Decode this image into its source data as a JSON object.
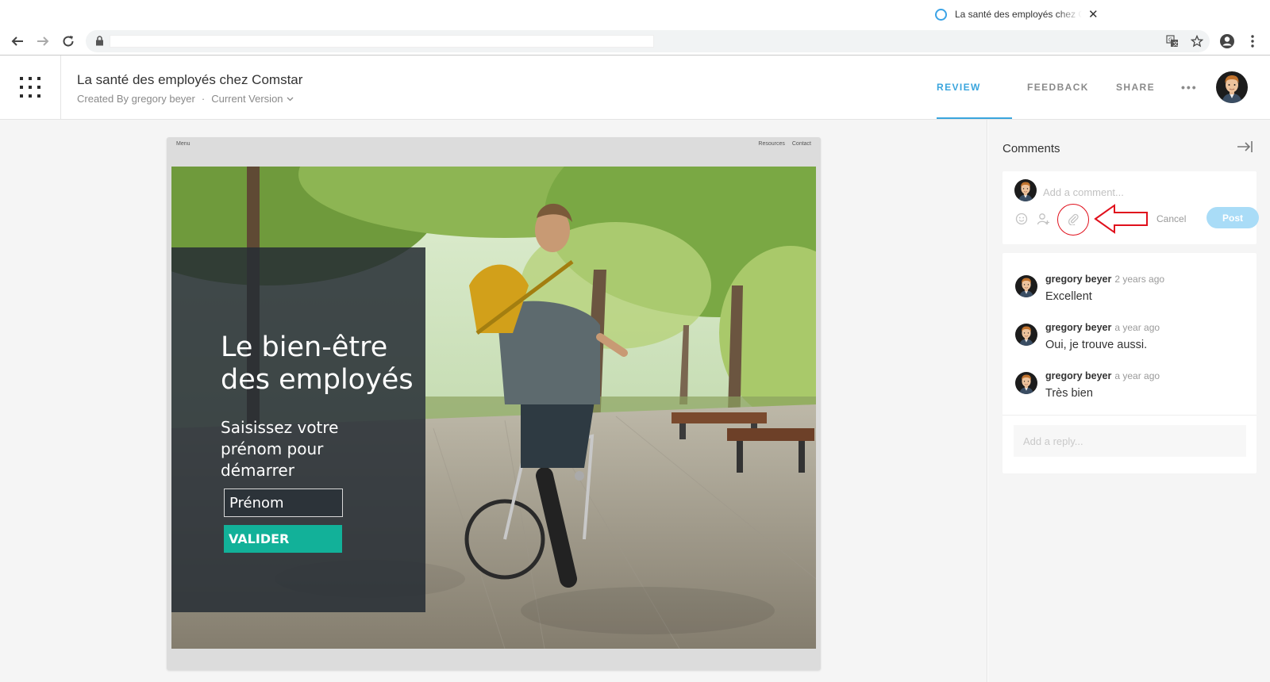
{
  "browser": {
    "tab_title": "La santé des employés chez Comstar",
    "tab_close": "✕"
  },
  "header": {
    "title": "La santé des employés chez Comstar",
    "created_by": "Created By gregory beyer",
    "separator": "·",
    "version": "Current Version",
    "nav": {
      "review": "REVIEW",
      "feedback": "FEEDBACK",
      "share": "SHARE",
      "more": "•••"
    }
  },
  "frame": {
    "nav_menu": "Menu",
    "nav_resources": "Resources",
    "nav_contact": "Contact",
    "hero_title_line1": "Le bien-être",
    "hero_title_line2": "des employés",
    "hero_subtitle": "Saisissez votre prénom pour démarrer",
    "input_placeholder": "Prénom",
    "button": "VALIDER"
  },
  "comments": {
    "title": "Comments",
    "compose_placeholder": "Add a comment...",
    "cancel": "Cancel",
    "post": "Post",
    "items": [
      {
        "author": "gregory beyer",
        "time": "2 years ago",
        "text": "Excellent"
      },
      {
        "author": "gregory beyer",
        "time": "a year ago",
        "text": "Oui, je trouve aussi."
      },
      {
        "author": "gregory beyer",
        "time": "a year ago",
        "text": "Très bien"
      }
    ],
    "reply_placeholder": "Add a reply..."
  },
  "colors": {
    "accent": "#3aa5dd",
    "cta": "#12b199",
    "annotation": "#e0101c"
  },
  "icons": {
    "back": "back-arrow-icon",
    "forward": "forward-arrow-icon",
    "reload": "reload-icon",
    "lock": "lock-icon",
    "translate": "translate-icon",
    "star": "star-icon",
    "account": "account-icon",
    "kebab": "kebab-menu-icon",
    "apps": "app-grid-icon",
    "collapse": "collapse-panel-icon",
    "emoji": "emoji-icon",
    "mention": "mention-user-icon",
    "attach": "paperclip-icon"
  }
}
